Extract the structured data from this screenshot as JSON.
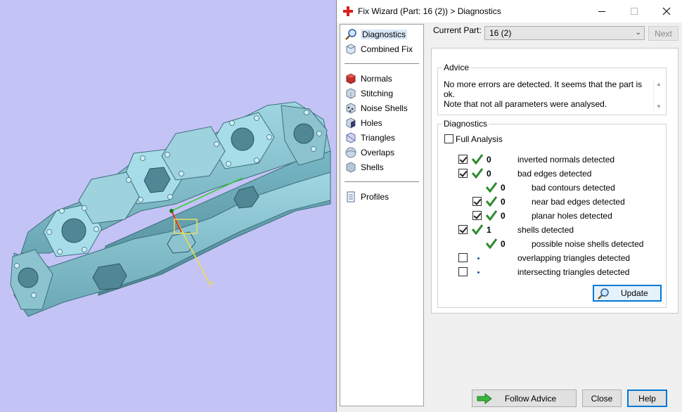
{
  "window": {
    "title": "Fix Wizard (Part: 16 (2)) > Diagnostics"
  },
  "nav": {
    "items": [
      {
        "label": "Diagnostics",
        "icon": "magnifier-icon"
      },
      {
        "label": "Combined Fix",
        "icon": "cube-icon"
      },
      {
        "label": "Normals",
        "icon": "normals-cube-icon"
      },
      {
        "label": "Stitching",
        "icon": "stitching-cube-icon"
      },
      {
        "label": "Noise Shells",
        "icon": "noise-shells-icon"
      },
      {
        "label": "Holes",
        "icon": "holes-cube-icon"
      },
      {
        "label": "Triangles",
        "icon": "triangles-icon"
      },
      {
        "label": "Overlaps",
        "icon": "overlaps-icon"
      },
      {
        "label": "Shells",
        "icon": "shells-icon"
      },
      {
        "label": "Profiles",
        "icon": "document-icon"
      }
    ]
  },
  "header": {
    "current_part_label": "Current Part:",
    "current_part_value": "16 (2)",
    "next_label": "Next"
  },
  "advice": {
    "title": "Advice",
    "line1": "No more errors are detected. It seems that the part is ok.",
    "line2": "Note that not all parameters were analysed."
  },
  "diagnostics": {
    "title": "Diagnostics",
    "full_analysis_label": "Full Analysis",
    "rows": [
      {
        "label": "inverted normals detected",
        "count": "0",
        "checked": true
      },
      {
        "label": "bad edges detected",
        "count": "0",
        "checked": true
      },
      {
        "label": "bad contours detected",
        "count": "0",
        "checked": false
      },
      {
        "label": "near bad edges detected",
        "count": "0",
        "checked": true
      },
      {
        "label": "planar holes detected",
        "count": "0",
        "checked": true
      },
      {
        "label": "shells detected",
        "count": "1",
        "checked": true
      },
      {
        "label": "possible noise shells detected",
        "count": "0",
        "checked": false
      },
      {
        "label": "overlapping triangles detected",
        "count": "",
        "checked": false
      },
      {
        "label": "intersecting triangles detected",
        "count": "",
        "checked": false
      }
    ],
    "update_label": "Update"
  },
  "footer": {
    "follow_advice_label": "Follow Advice",
    "close_label": "Close",
    "help_label": "Help"
  },
  "viewport": {
    "axis_label": "y"
  },
  "colors": {
    "accent": "#0078d7",
    "model": "#86c5d3",
    "background": "#c4c3f6",
    "check": "#2e8b2e"
  }
}
